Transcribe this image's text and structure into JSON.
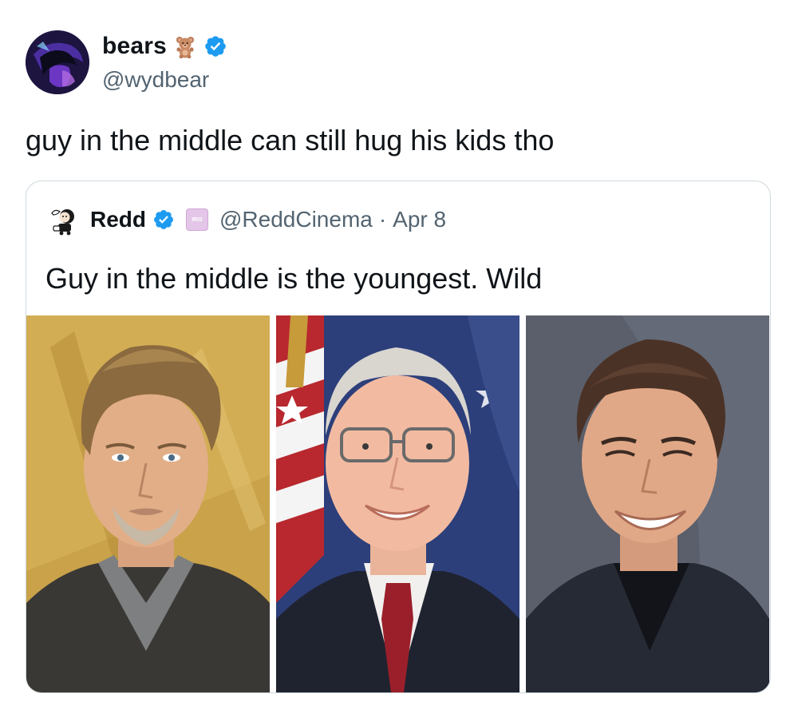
{
  "tweet": {
    "author": {
      "display_name": "bears",
      "emoji_icon": "teddy-bear-emoji-icon",
      "verified_icon": "verified-badge-icon",
      "handle": "@wydbear"
    },
    "text": "guy in the middle can still hug his kids tho"
  },
  "quoted_tweet": {
    "author": {
      "display_name": "Redd",
      "verified_icon": "verified-badge-icon",
      "affiliate_badge": "IRIS",
      "handle": "@ReddCinema"
    },
    "separator": "·",
    "date": "Apr 8",
    "text": "Guy in the middle is the youngest. Wild",
    "photos": [
      {
        "subject": "man with tousled hair and goatee",
        "background_color": "#c9a24a"
      },
      {
        "subject": "man with glasses in suit and red tie",
        "background_color": "#2c3f7a"
      },
      {
        "subject": "smiling man with dark hair",
        "background_color": "#5a5f6b"
      }
    ]
  },
  "colors": {
    "text": "#0f1419",
    "secondary_text": "#536471",
    "verified_blue": "#1d9bf0",
    "border": "#cfd9de"
  }
}
